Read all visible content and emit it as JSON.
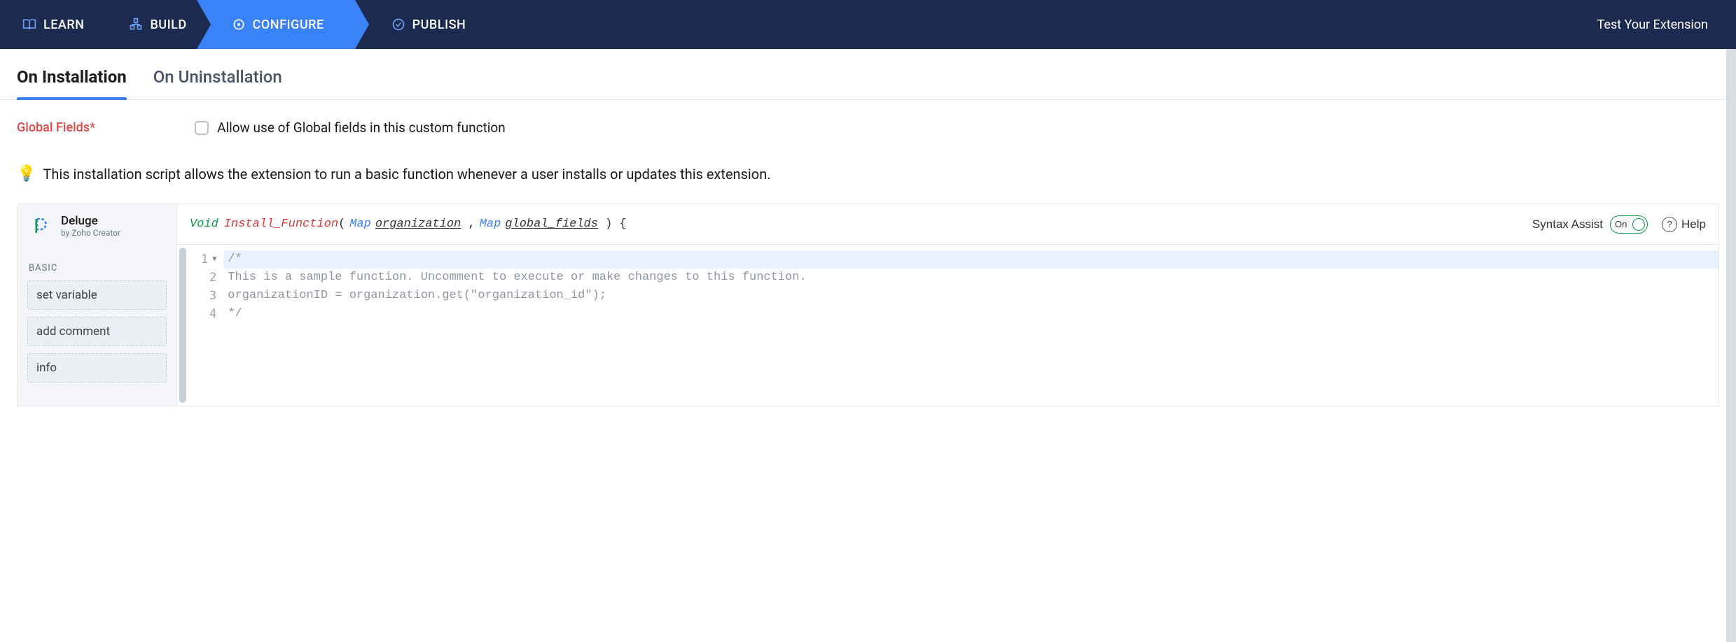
{
  "colors": {
    "accent": "#3a82f7",
    "navbg": "#1b2a4e",
    "danger": "#e04848",
    "green": "#0c9a4a"
  },
  "nav": {
    "items": [
      {
        "label": "LEARN",
        "icon": "book-icon"
      },
      {
        "label": "BUILD",
        "icon": "blocks-icon"
      },
      {
        "label": "CONFIGURE",
        "icon": "target-icon"
      },
      {
        "label": "PUBLISH",
        "icon": "check-circle-icon"
      }
    ],
    "active_index": 2,
    "test_label": "Test Your Extension"
  },
  "subtabs": {
    "items": [
      "On Installation",
      "On Uninstallation"
    ],
    "active_index": 0
  },
  "global_fields": {
    "label": "Global Fields",
    "required_marker": "*",
    "checkbox_label": "Allow use of Global fields in this custom function",
    "checked": false
  },
  "hint": "This installation script allows the extension to run a basic function whenever a user installs or updates this extension.",
  "editor": {
    "brand": {
      "name": "Deluge",
      "subtitle": "by Zoho Creator"
    },
    "side": {
      "category": "BASIC",
      "snippets": [
        "set variable",
        "add comment",
        "info"
      ]
    },
    "signature": {
      "return_kw": "Void",
      "fn_name": "Install_Function",
      "params": [
        {
          "type": "Map",
          "name": "organization"
        },
        {
          "type": "Map",
          "name": "global_fields"
        }
      ]
    },
    "syntax_assist_label": "Syntax Assist",
    "syntax_assist_state": "On",
    "help_label": "Help",
    "code_lines": [
      "/*",
      "This is a sample function. Uncomment to execute or make changes to this function.",
      "organizationID = organization.get(\"organization_id\");",
      "*/"
    ]
  }
}
